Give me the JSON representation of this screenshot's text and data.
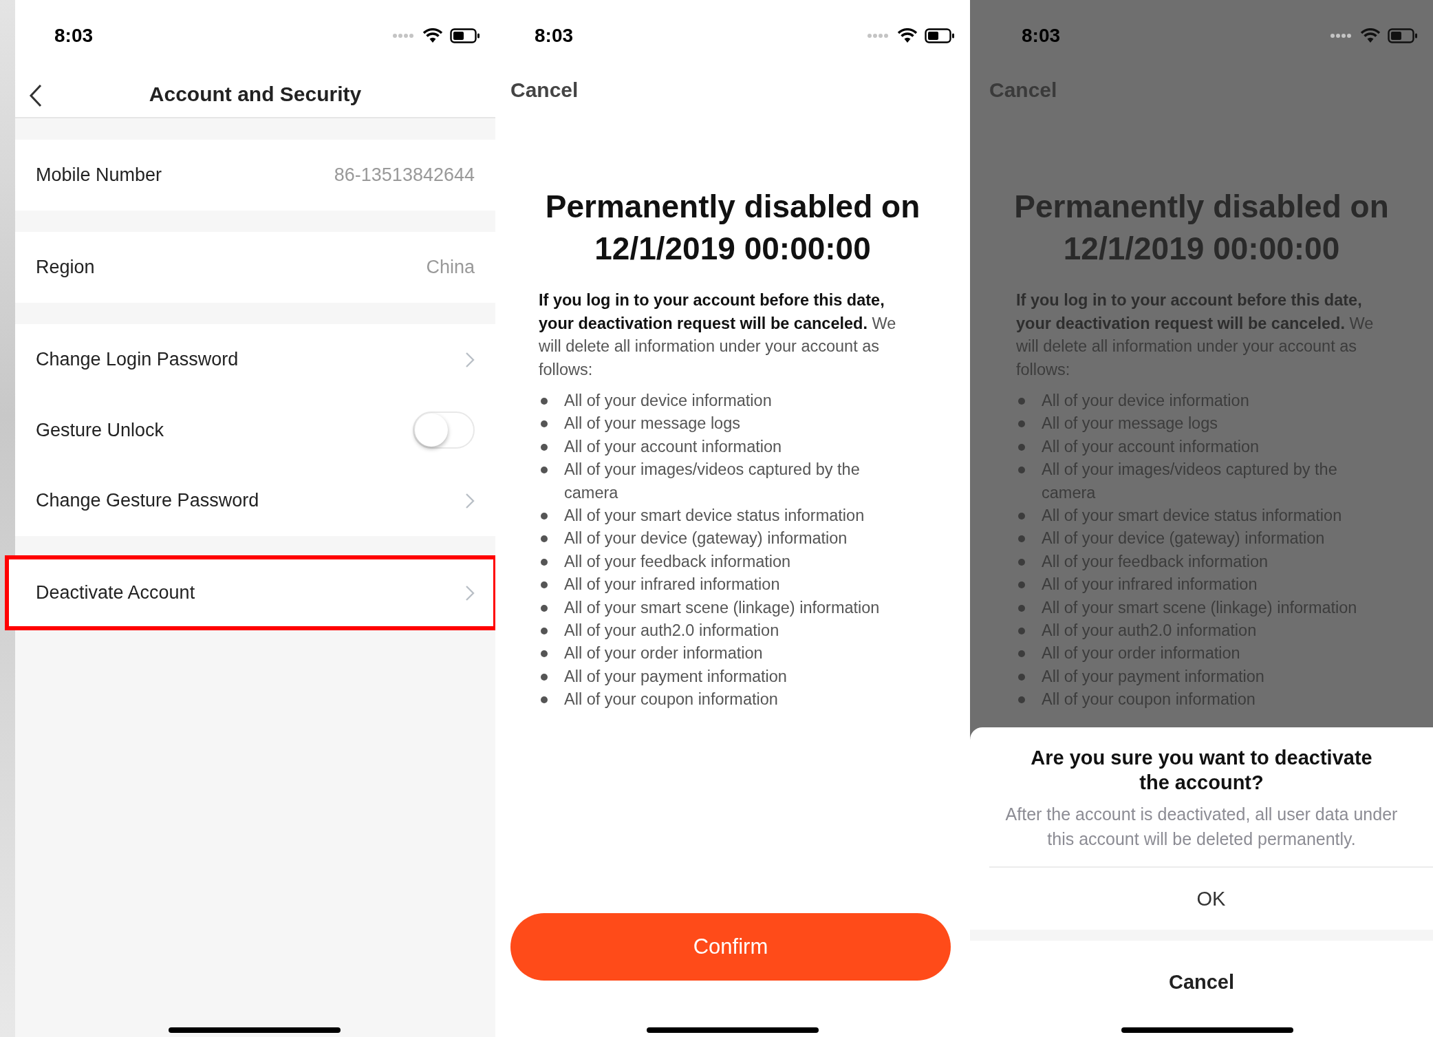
{
  "screens": [
    {
      "kind": "settings",
      "status_bar": {
        "time": "8:03"
      },
      "nav": {
        "title": "Account and Security"
      },
      "groups": [
        [
          {
            "kind": "value",
            "label": "Mobile Number",
            "value": "86-13513842644",
            "highlighted": false
          }
        ],
        [
          {
            "kind": "value",
            "label": "Region",
            "value": "China",
            "highlighted": false
          }
        ],
        [
          {
            "kind": "link",
            "label": "Change Login Password",
            "highlighted": false
          },
          {
            "kind": "toggle",
            "label": "Gesture Unlock",
            "on": false,
            "highlighted": false
          },
          {
            "kind": "link",
            "label": "Change Gesture Password",
            "highlighted": false
          }
        ],
        [
          {
            "kind": "link",
            "label": "Deactivate Account",
            "highlighted": true
          }
        ]
      ]
    },
    {
      "kind": "notice",
      "dimmed": false,
      "status_bar": {
        "time": "8:03"
      },
      "cancel": "Cancel",
      "heading_lines": [
        "Permanently disabled on",
        "12/1/2019 00:00:00"
      ],
      "intro": "**If you log in to your account before this date, your deactivation request will be canceled.** We will delete all information under your account as follows:",
      "items": [
        "All of your device information",
        "All of your message logs",
        "All of your account information",
        "All of your images/videos captured by the camera",
        "All of your smart device status information",
        "All of your device (gateway) information",
        "All of your feedback information",
        "All of your infrared information",
        "All of your smart scene (linkage) information",
        "All of your auth2.0 information",
        "All of your order information",
        "All of your payment information",
        "All of your coupon information"
      ],
      "confirm": "Confirm"
    },
    {
      "kind": "notice",
      "dimmed": true,
      "status_bar": {
        "time": "8:03"
      },
      "cancel": "Cancel",
      "heading_lines": [
        "Permanently disabled on",
        "12/1/2019 00:00:00"
      ],
      "intro": "**If you log in to your account before this date, your deactivation request will be canceled.** We will delete all information under your account as follows:",
      "items": [
        "All of your device information",
        "All of your message logs",
        "All of your account information",
        "All of your images/videos captured by the camera",
        "All of your smart device status information",
        "All of your device (gateway) information",
        "All of your feedback information",
        "All of your infrared information",
        "All of your smart scene (linkage) information",
        "All of your auth2.0 information",
        "All of your order information",
        "All of your payment information",
        "All of your coupon information"
      ],
      "dialog": {
        "title": "Are you sure you want to deactivate the account?",
        "message": "After the account is deactivated, all user data under this account will be deleted permanently.",
        "ok": "OK",
        "cancel": "Cancel"
      }
    }
  ]
}
